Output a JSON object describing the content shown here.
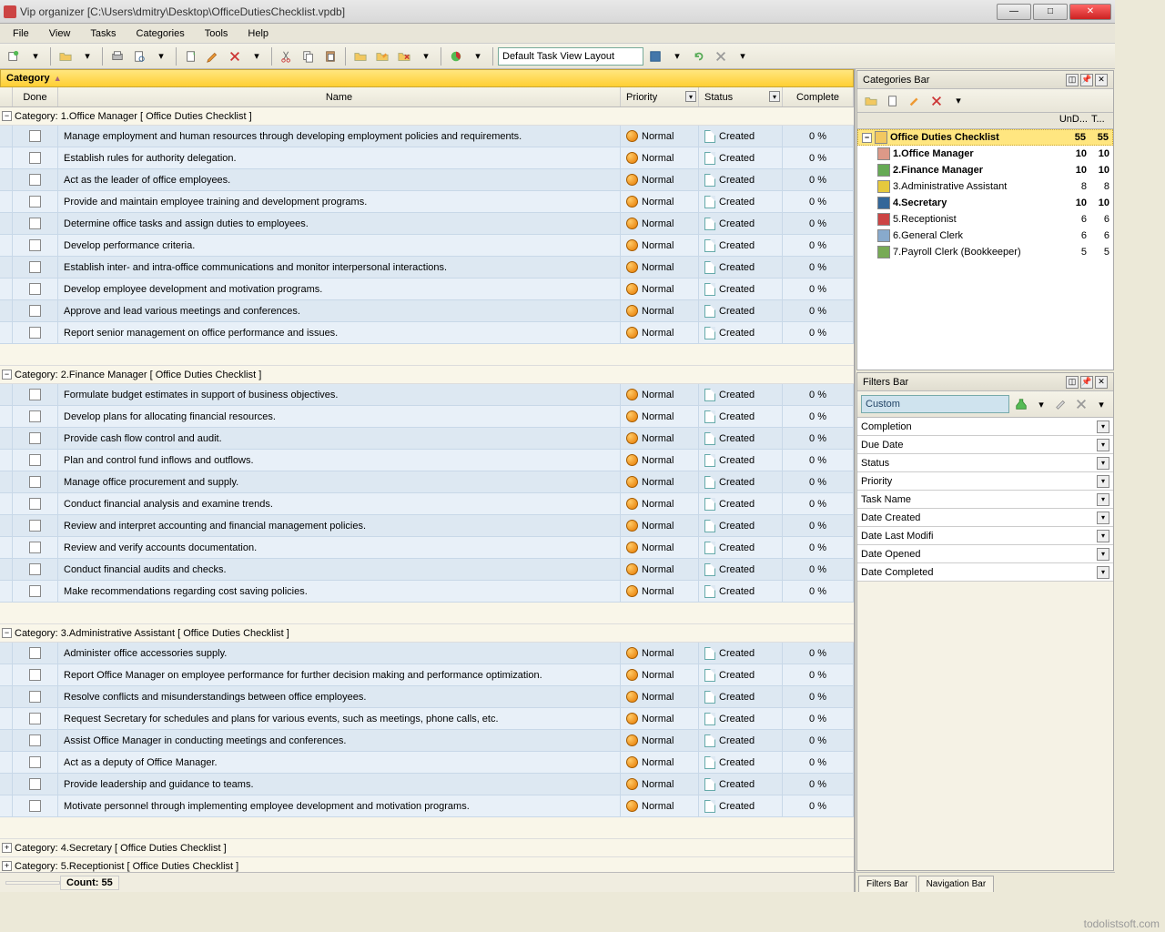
{
  "window": {
    "title": "Vip organizer [C:\\Users\\dmitry\\Desktop\\OfficeDutiesChecklist.vpdb]"
  },
  "menu": [
    "File",
    "View",
    "Tasks",
    "Categories",
    "Tools",
    "Help"
  ],
  "layout_combo": "Default Task View Layout",
  "group_header": "Category",
  "columns": {
    "done": "Done",
    "name": "Name",
    "priority": "Priority",
    "status": "Status",
    "complete": "Complete"
  },
  "priority_label": "Normal",
  "status_label": "Created",
  "complete_label": "0 %",
  "groups": [
    {
      "title": "Category: 1.Office Manager   [ Office Duties Checklist ]",
      "expanded": true,
      "tasks": [
        "Manage employment and human resources through developing employment policies and requirements.",
        "Establish rules for authority delegation.",
        "Act as the leader of office employees.",
        "Provide and maintain employee training and development programs.",
        "Determine office tasks and assign duties to employees.",
        "Develop performance criteria.",
        "Establish inter- and intra-office communications and monitor interpersonal interactions.",
        "Develop employee development and motivation programs.",
        "Approve and lead various meetings and conferences.",
        "Report senior management on office performance and issues."
      ]
    },
    {
      "title": "Category: 2.Finance Manager   [ Office Duties Checklist ]",
      "expanded": true,
      "tasks": [
        "Formulate budget estimates in support of business objectives.",
        "Develop plans for allocating financial resources.",
        "Provide cash flow control and audit.",
        "Plan and control fund inflows and outflows.",
        "Manage office procurement and supply.",
        "Conduct financial analysis and examine trends.",
        "Review and interpret accounting and financial management policies.",
        "Review and verify accounts documentation.",
        "Conduct financial audits and checks.",
        "Make recommendations regarding cost saving policies."
      ]
    },
    {
      "title": "Category: 3.Administrative Assistant   [ Office Duties Checklist ]",
      "expanded": true,
      "tasks": [
        "Administer office accessories supply.",
        "Report Office Manager on employee performance for further decision making and performance optimization.",
        "Resolve conflicts and misunderstandings between office employees.",
        "Request Secretary for schedules and plans for various events, such as meetings, phone calls, etc.",
        "Assist Office Manager in conducting meetings and conferences.",
        "Act as a deputy of Office Manager.",
        "Provide leadership and guidance to teams.",
        "Motivate personnel through implementing employee development and motivation programs."
      ]
    },
    {
      "title": "Category: 4.Secretary   [ Office Duties Checklist ]",
      "expanded": false,
      "tasks": []
    },
    {
      "title": "Category: 5.Receptionist   [ Office Duties Checklist ]",
      "expanded": false,
      "tasks": []
    }
  ],
  "status_count": "Count:  55",
  "categories_panel": {
    "title": "Categories Bar",
    "cols": {
      "c1": "UnD...",
      "c2": "T..."
    },
    "items": [
      {
        "label": "Office Duties Checklist",
        "n1": "55",
        "n2": "55",
        "bold": true,
        "sel": true,
        "color": "#f2c860"
      },
      {
        "label": "1.Office Manager",
        "n1": "10",
        "n2": "10",
        "bold": true,
        "color": "#d98"
      },
      {
        "label": "2.Finance Manager",
        "n1": "10",
        "n2": "10",
        "bold": true,
        "color": "#6a5"
      },
      {
        "label": "3.Administrative Assistant",
        "n1": "8",
        "n2": "8",
        "bold": false,
        "color": "#e6c93d"
      },
      {
        "label": "4.Secretary",
        "n1": "10",
        "n2": "10",
        "bold": true,
        "color": "#369"
      },
      {
        "label": "5.Receptionist",
        "n1": "6",
        "n2": "6",
        "bold": false,
        "color": "#c44"
      },
      {
        "label": "6.General Clerk",
        "n1": "6",
        "n2": "6",
        "bold": false,
        "color": "#8ac"
      },
      {
        "label": "7.Payroll Clerk (Bookkeeper)",
        "n1": "5",
        "n2": "5",
        "bold": false,
        "color": "#7a5"
      }
    ]
  },
  "filters_panel": {
    "title": "Filters Bar",
    "custom": "Custom",
    "fields": [
      "Completion",
      "Due Date",
      "Status",
      "Priority",
      "Task Name",
      "Date Created",
      "Date Last Modifi",
      "Date Opened",
      "Date Completed"
    ]
  },
  "bottom_tabs": [
    "Filters Bar",
    "Navigation Bar"
  ],
  "watermark": "todolistsoft.com"
}
